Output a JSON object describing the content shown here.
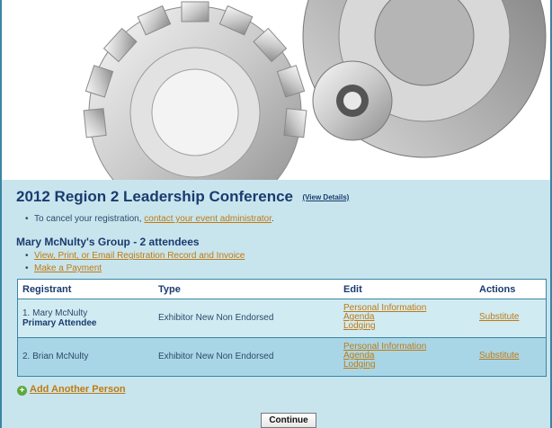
{
  "event": {
    "title": "2012 Region 2 Leadership Conference",
    "view_details_label": "(View Details)"
  },
  "notice": {
    "prefix": "To cancel your registration, ",
    "link_label": "contact your event administrator",
    "suffix": "."
  },
  "group": {
    "title": "Mary McNulty's Group - 2 attendees",
    "links": [
      "View, Print, or Email Registration Record and Invoice",
      "Make a Payment"
    ]
  },
  "table": {
    "headers": [
      "Registrant",
      "Type",
      "Edit",
      "Actions"
    ],
    "rows": [
      {
        "registrant": "1. Mary McNulty",
        "role": "Primary Attendee",
        "type": "Exhibitor New Non Endorsed",
        "edit": [
          "Personal Information",
          "Agenda",
          "Lodging"
        ],
        "action": "Substitute"
      },
      {
        "registrant": "2. Brian McNulty",
        "role": "",
        "type": "Exhibitor New Non Endorsed",
        "edit": [
          "Personal Information",
          "Agenda",
          "Lodging"
        ],
        "action": "Substitute"
      }
    ]
  },
  "add_person_label": "Add Another Person",
  "continue_label": "Continue"
}
